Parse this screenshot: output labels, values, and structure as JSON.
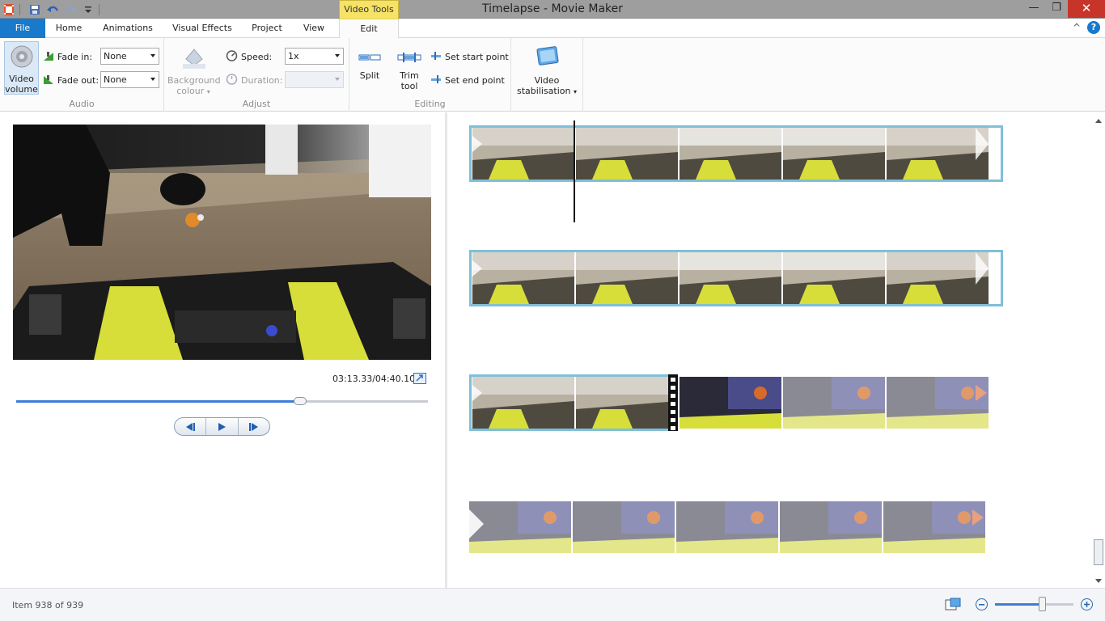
{
  "window": {
    "title": "Timelapse - Movie Maker",
    "context_tab": "Video Tools",
    "minimize_glyph": "—",
    "restore_glyph": "❐",
    "close_glyph": "✕"
  },
  "tabs": [
    "File",
    "Home",
    "Animations",
    "Visual Effects",
    "Project",
    "View",
    "Edit"
  ],
  "tabs_right": {
    "collapse_glyph": "^",
    "help_glyph": "?"
  },
  "ribbon": {
    "audio": {
      "label": "Audio",
      "video_volume": [
        "Video",
        "volume"
      ],
      "fade_in_label": "Fade in:",
      "fade_in_value": "None",
      "fade_out_label": "Fade out:",
      "fade_out_value": "None"
    },
    "adjust": {
      "label": "Adjust",
      "background_colour": [
        "Background",
        "colour"
      ],
      "speed_label": "Speed:",
      "speed_value": "1x",
      "duration_label": "Duration:",
      "duration_value": ""
    },
    "editing": {
      "label": "Editing",
      "split": "Split",
      "trim_tool": [
        "Trim",
        "tool"
      ],
      "set_start_point": "Set start point",
      "set_end_point": "Set end point"
    },
    "stabilisation": {
      "video_stabilisation": [
        "Video",
        "stabilisation"
      ]
    }
  },
  "preview": {
    "timecode": "03:13.33/04:40.10",
    "progress": 0.69
  },
  "status": {
    "item_text": "Item 938 of 939",
    "zoom_level": 0.6
  },
  "colors": {
    "file_tab": "#1979ca",
    "context_tab": "#f5e266",
    "clip_selected_border": "#7fbfd9",
    "close_button": "#c7352a"
  }
}
